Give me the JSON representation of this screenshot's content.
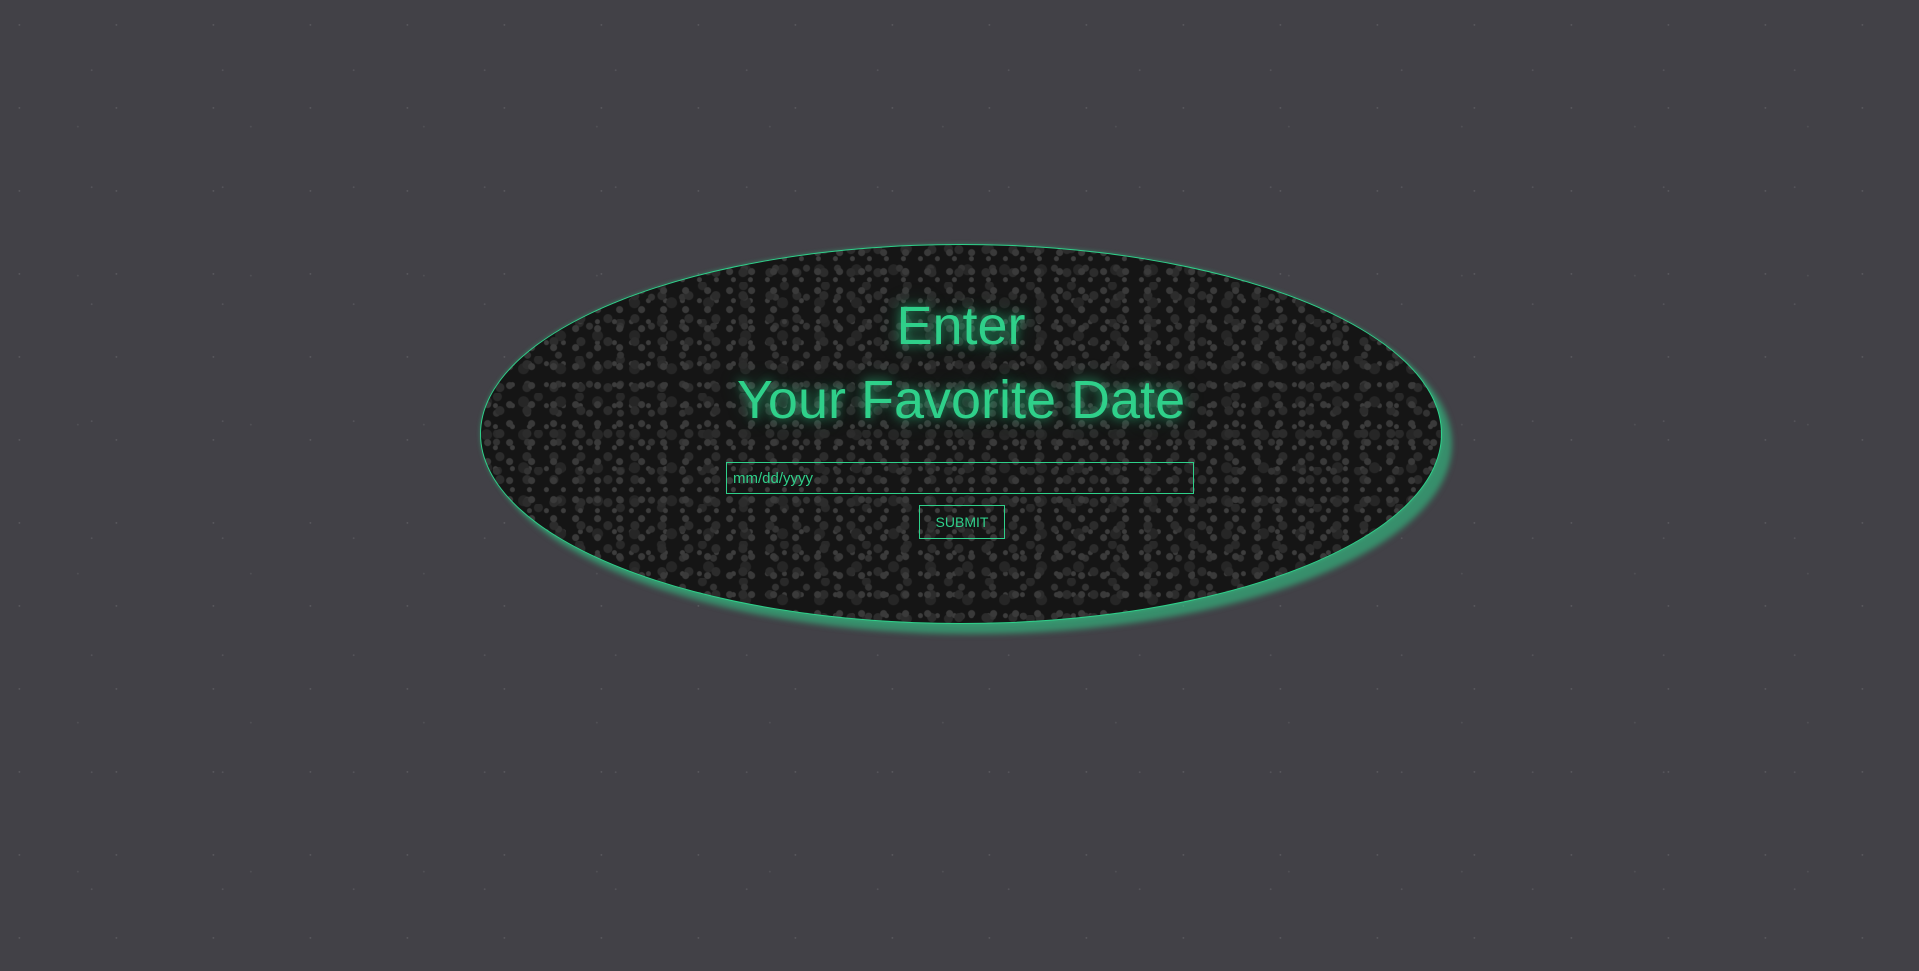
{
  "form": {
    "title_line1": "Enter",
    "title_line2": "Your Favorite Date",
    "date_placeholder": "mm/dd/yyyy",
    "date_value": "",
    "submit_label": "SUBMIT"
  },
  "colors": {
    "background": "#424147",
    "accent": "#2fd08a",
    "panel": "#151515"
  }
}
